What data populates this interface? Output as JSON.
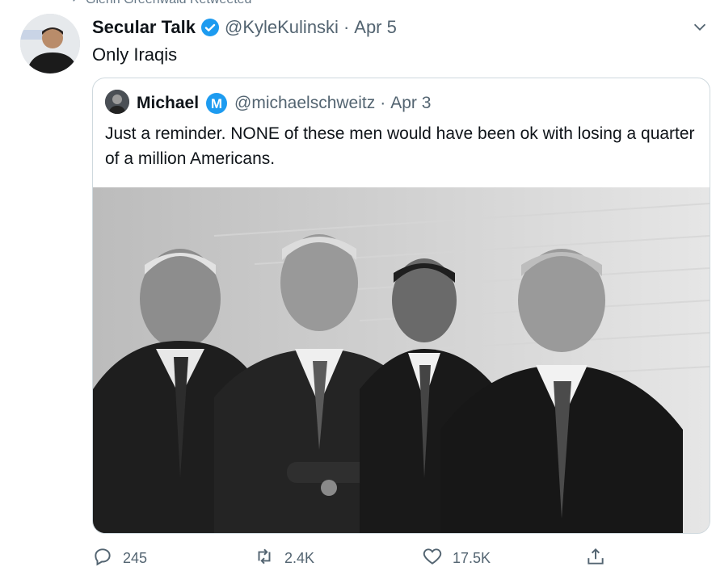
{
  "retweet_header": {
    "text": "Glenn Greenwald Retweeted",
    "icon": "retweet-icon"
  },
  "tweet": {
    "author_name": "Secular Talk",
    "verified": true,
    "handle": "@KyleKulinski",
    "separator": "·",
    "date": "Apr 5",
    "text": "Only Iraqis",
    "avatar_icon": "user-avatar"
  },
  "quoted_tweet": {
    "author_name": "Michael",
    "badge_icon": "m-circle-badge-icon",
    "handle": "@michaelschweitz",
    "separator": "·",
    "date": "Apr 3",
    "text": "Just a reminder. NONE of these men would have been ok with losing a quarter of a million Americans.",
    "image_description_icon": "black-and-white-photo"
  },
  "actions": {
    "replies": "245",
    "retweets": "2.4K",
    "likes": "17.5K"
  },
  "colors": {
    "verified": "#1d9bf0",
    "muted": "#536471",
    "text": "#0f1419",
    "border": "#cfd9de"
  }
}
